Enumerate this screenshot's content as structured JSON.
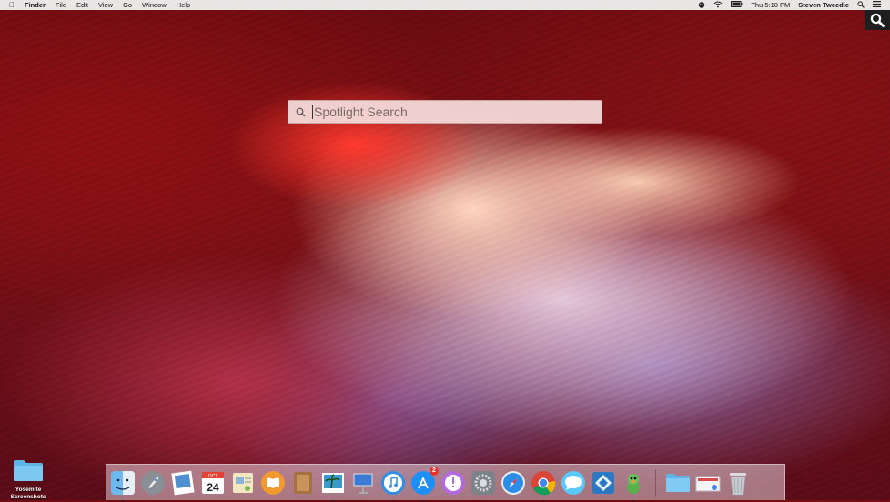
{
  "menubar": {
    "app_name": "Finder",
    "menus": [
      "File",
      "Edit",
      "View",
      "Go",
      "Window",
      "Help"
    ],
    "clock": "Thu 5:10 PM",
    "user": "Steven Tweedie"
  },
  "spotlight": {
    "placeholder": "Spotlight Search",
    "value": ""
  },
  "desktop": {
    "items": [
      {
        "label": "Yosemite Screenshots"
      }
    ]
  },
  "dock": {
    "calendar_day": "24",
    "calendar_month": "OCT",
    "app_store_badge": "2"
  },
  "colors": {
    "menubar_bg": "#e9e6e6",
    "spotlight_bg": "#f5dedc",
    "wallpaper_main": "#7a1016"
  }
}
